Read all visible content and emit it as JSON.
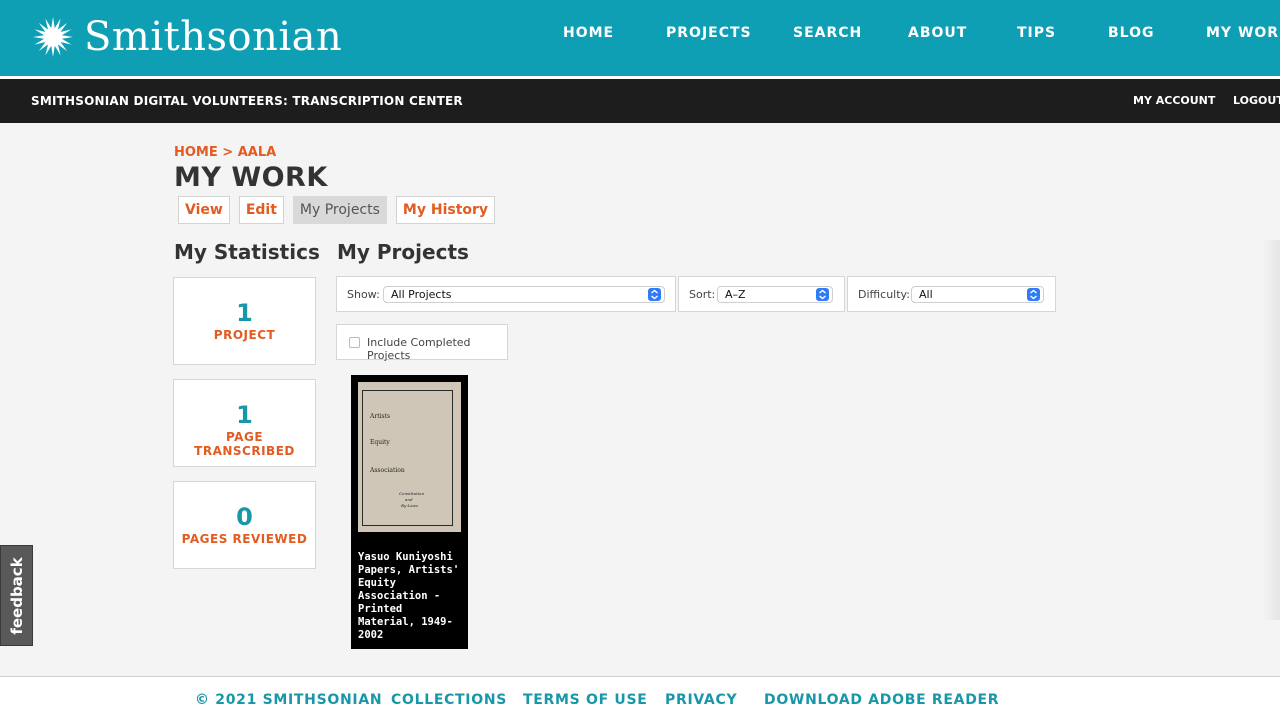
{
  "brand": {
    "name": "Smithsonian",
    "logo_icon": "sunburst-icon",
    "color": "#0f9fb4"
  },
  "main_nav": [
    {
      "label": "HOME"
    },
    {
      "label": "PROJECTS"
    },
    {
      "label": "SEARCH"
    },
    {
      "label": "ABOUT"
    },
    {
      "label": "TIPS"
    },
    {
      "label": "BLOG"
    },
    {
      "label": "MY WORK"
    }
  ],
  "subbar": {
    "title": "SMITHSONIAN DIGITAL VOLUNTEERS: TRANSCRIPTION CENTER",
    "my_account": "MY ACCOUNT",
    "logout": "LOGOUT"
  },
  "breadcrumb": {
    "home": "HOME",
    "separator": " > ",
    "current": "AALA"
  },
  "page_title": "MY WORK",
  "tabs": [
    {
      "label": "View",
      "active": false
    },
    {
      "label": "Edit",
      "active": false
    },
    {
      "label": "My Projects",
      "active": true
    },
    {
      "label": "My History",
      "active": false
    }
  ],
  "statistics": {
    "heading": "My Statistics",
    "items": [
      {
        "value": "1",
        "label": "PROJECT"
      },
      {
        "value": "1",
        "label": "PAGE TRANSCRIBED"
      },
      {
        "value": "0",
        "label": "PAGES REVIEWED"
      }
    ]
  },
  "projects": {
    "heading": "My Projects",
    "filters": {
      "show": {
        "label": "Show:",
        "value": "All Projects"
      },
      "sort": {
        "label": "Sort:",
        "value": "A–Z"
      },
      "difficulty": {
        "label": "Difficulty:",
        "value": "All"
      }
    },
    "include_completed": {
      "label": "Include Completed Projects",
      "checked": false
    },
    "cards": [
      {
        "title": "Yasuo Kuniyoshi Papers, Artists' Equity Association - Printed Material, 1949-2002",
        "thumb_lines": [
          "Artists",
          "Equity",
          "Association",
          "Constitution",
          "and",
          "By-Laws"
        ]
      }
    ]
  },
  "feedback_label": "feedback",
  "footer": [
    {
      "label": "© 2021 SMITHSONIAN"
    },
    {
      "label": "COLLECTIONS"
    },
    {
      "label": "TERMS OF USE"
    },
    {
      "label": "PRIVACY"
    },
    {
      "label": "DOWNLOAD ADOBE READER"
    }
  ],
  "colors": {
    "accent_orange": "#e35b21",
    "accent_teal": "#1897a8",
    "subbar_black": "#1d1d1d"
  }
}
